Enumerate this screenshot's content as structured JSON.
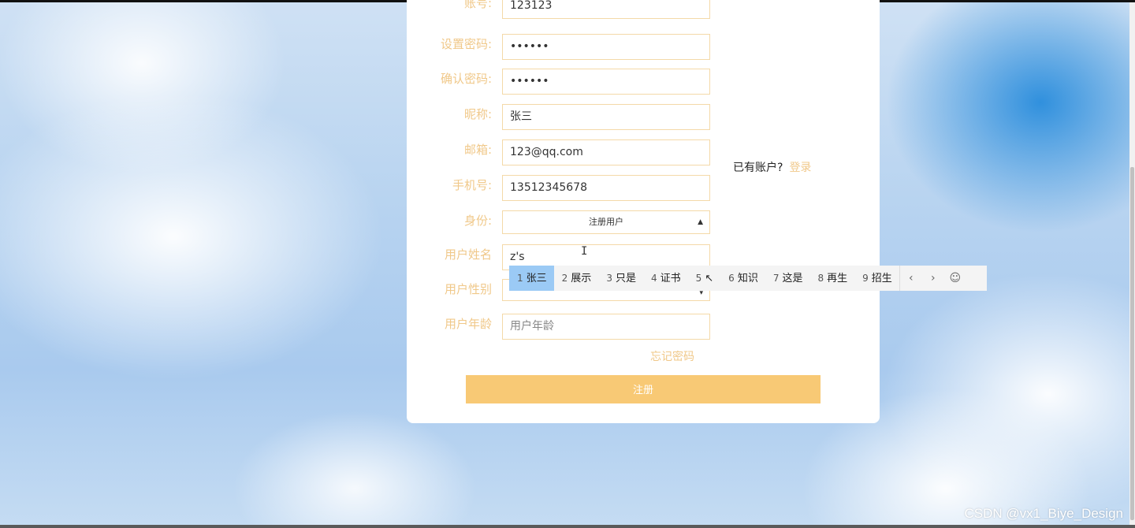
{
  "form": {
    "account_label": "账号:",
    "account_value": "123123",
    "password_label": "设置密码:",
    "password_value": "••••••",
    "confirm_label": "确认密码:",
    "confirm_value": "••••••",
    "nickname_label": "昵称:",
    "nickname_value": "张三",
    "email_label": "邮箱:",
    "email_value": "123@qq.com",
    "phone_label": "手机号:",
    "phone_value": "13512345678",
    "identity_label": "身份:",
    "identity_selected": "注册用户",
    "username_label": "用户姓名",
    "username_value": "z's",
    "gender_label": "用户性别",
    "gender_arrow": "▾",
    "age_label": "用户年龄",
    "age_placeholder": "用户年龄",
    "forgot_password": "忘记密码",
    "register_button": "注册"
  },
  "login_hint": {
    "text": "已有账户?",
    "link": "登录"
  },
  "ime": {
    "candidates": [
      {
        "num": "1",
        "text": "张三"
      },
      {
        "num": "2",
        "text": "展示"
      },
      {
        "num": "3",
        "text": "只是"
      },
      {
        "num": "4",
        "text": "证书"
      },
      {
        "num": "5",
        "text": "↖"
      },
      {
        "num": "6",
        "text": "知识"
      },
      {
        "num": "7",
        "text": "这是"
      },
      {
        "num": "8",
        "text": "再生"
      },
      {
        "num": "9",
        "text": "招生"
      }
    ],
    "prev_icon": "‹",
    "next_icon": "›",
    "emoji_icon": "☺"
  },
  "watermark": "CSDN @vx1_Biye_Design",
  "colors": {
    "label": "#f0c889",
    "button": "#f8c975",
    "ime_highlight": "#9bcaf5"
  }
}
